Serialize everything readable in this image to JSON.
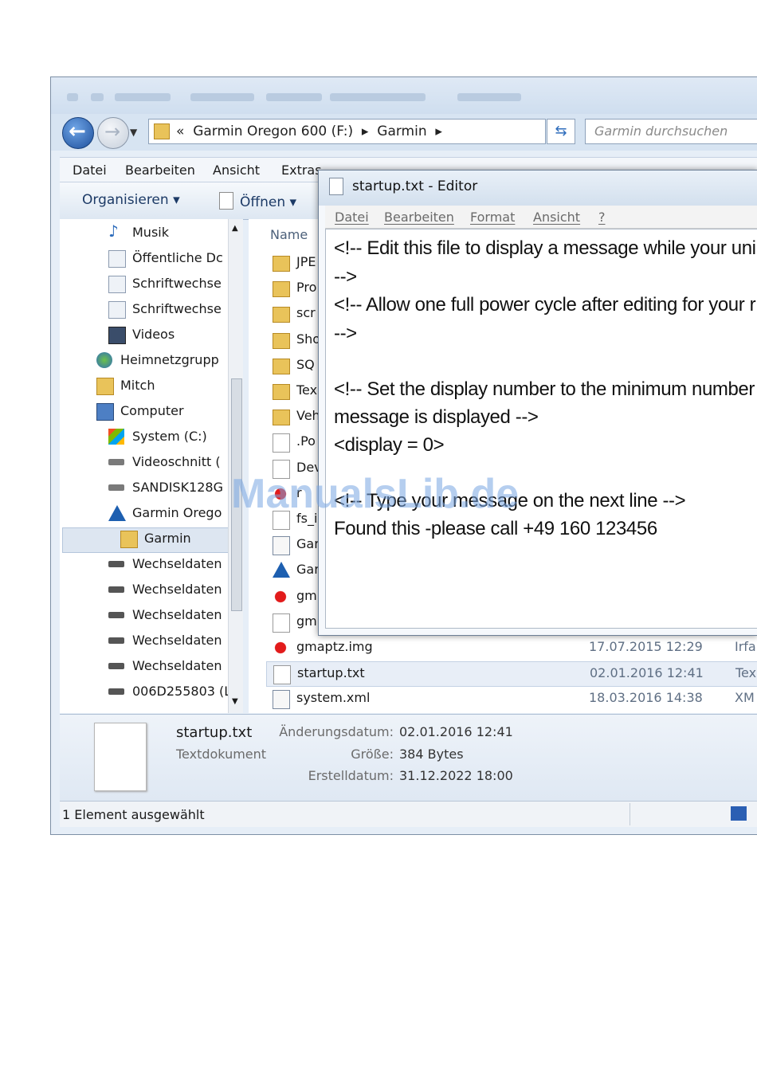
{
  "explorer": {
    "address_back_glyph": "«",
    "address_path": [
      "Garmin Oregon 600 (F:)",
      "Garmin"
    ],
    "search_placeholder": "Garmin durchsuchen",
    "menu": [
      "Datei",
      "Bearbeiten",
      "Ansicht",
      "Extras"
    ],
    "toolbar": {
      "organize": "Organisieren",
      "open": "Öffnen"
    },
    "nav_items": [
      {
        "label": "Musik",
        "icon": "music-icon"
      },
      {
        "label": "Öffentliche Dc",
        "icon": "library-icon"
      },
      {
        "label": "Schriftwechse",
        "icon": "library-icon"
      },
      {
        "label": "Schriftwechse",
        "icon": "library-icon"
      },
      {
        "label": "Videos",
        "icon": "video-icon"
      },
      {
        "label": "Heimnetzgrupp",
        "icon": "homegroup-icon"
      },
      {
        "label": "Mitch",
        "icon": "user-folder-icon"
      },
      {
        "label": "Computer",
        "icon": "computer-icon"
      },
      {
        "label": "System (C:)",
        "icon": "system-drive-icon"
      },
      {
        "label": "Videoschnitt (",
        "icon": "drive-icon"
      },
      {
        "label": "SANDISK128G",
        "icon": "drive-icon"
      },
      {
        "label": "Garmin Orego",
        "icon": "garmin-icon"
      },
      {
        "label": "Garmin",
        "icon": "folder-icon"
      },
      {
        "label": "Wechseldaten",
        "icon": "drive-icon"
      },
      {
        "label": "Wechseldaten",
        "icon": "drive-icon"
      },
      {
        "label": "Wechseldaten",
        "icon": "drive-icon"
      },
      {
        "label": "Wechseldaten",
        "icon": "drive-icon"
      },
      {
        "label": "Wechseldaten",
        "icon": "drive-icon"
      },
      {
        "label": "006D255803 (L",
        "icon": "drive-icon"
      }
    ],
    "column_name": "Name",
    "files": [
      {
        "name": "JPE",
        "date": "",
        "type": "",
        "icon": "folder-icon"
      },
      {
        "name": "Pro",
        "date": "",
        "type": "",
        "icon": "folder-icon"
      },
      {
        "name": "scr",
        "date": "",
        "type": "",
        "icon": "folder-icon"
      },
      {
        "name": "Sho",
        "date": "",
        "type": "",
        "icon": "folder-icon"
      },
      {
        "name": "SQ",
        "date": "",
        "type": "",
        "icon": "folder-icon"
      },
      {
        "name": "Tex",
        "date": "",
        "type": "",
        "icon": "folder-icon"
      },
      {
        "name": "Veh",
        "date": "",
        "type": "",
        "icon": "folder-icon"
      },
      {
        "name": ".Po",
        "date": "",
        "type": "",
        "icon": "file-icon"
      },
      {
        "name": "Dev",
        "date": "",
        "type": "",
        "icon": "file-icon"
      },
      {
        "name": "r",
        "date": "",
        "type": "",
        "icon": "irfanview-icon"
      },
      {
        "name": "fs_i",
        "date": "",
        "type": "",
        "icon": "file-icon"
      },
      {
        "name": "Gar",
        "date": "",
        "type": "",
        "icon": "xml-icon"
      },
      {
        "name": "Gar",
        "date": "",
        "type": "",
        "icon": "garmin-icon"
      },
      {
        "name": "gm",
        "date": "",
        "type": "",
        "icon": "irfanview-icon"
      },
      {
        "name": "gm",
        "date": "",
        "type": "",
        "icon": "file-icon"
      },
      {
        "name": "gmaptz.img",
        "date": "17.07.2015 12:29",
        "type": "Irfar",
        "icon": "irfanview-icon"
      },
      {
        "name": "startup.txt",
        "date": "02.01.2016 12:41",
        "type": "Tex",
        "icon": "text-file-icon",
        "selected": true
      },
      {
        "name": "system.xml",
        "date": "18.03.2016 14:38",
        "type": "XM",
        "icon": "xml-icon"
      }
    ],
    "details": {
      "name": "startup.txt",
      "type": "Textdokument",
      "modified_label": "Änderungsdatum:",
      "modified": "02.01.2016 12:41",
      "size_label": "Größe:",
      "size": "384 Bytes",
      "created_label": "Erstelldatum:",
      "created": "31.12.2022 18:00"
    },
    "status": "1 Element ausgewählt"
  },
  "notepad": {
    "title": "startup.txt - Editor",
    "menu": [
      "Datei",
      "Bearbeiten",
      "Format",
      "Ansicht",
      "?"
    ],
    "lines": [
      "<!-- Edit this file to display a message while your uni",
      "-->",
      "<!-- Allow one full power cycle after editing for your r",
      "   -->",
      "",
      "<!-- Set the display number to the minimum number",
      "message is displayed -->",
      "<display = 0>",
      "",
      "<!-- Type your message on the next line -->",
      "Found this -please call +49 160 123456"
    ]
  },
  "watermark": "ManualsLib.de"
}
